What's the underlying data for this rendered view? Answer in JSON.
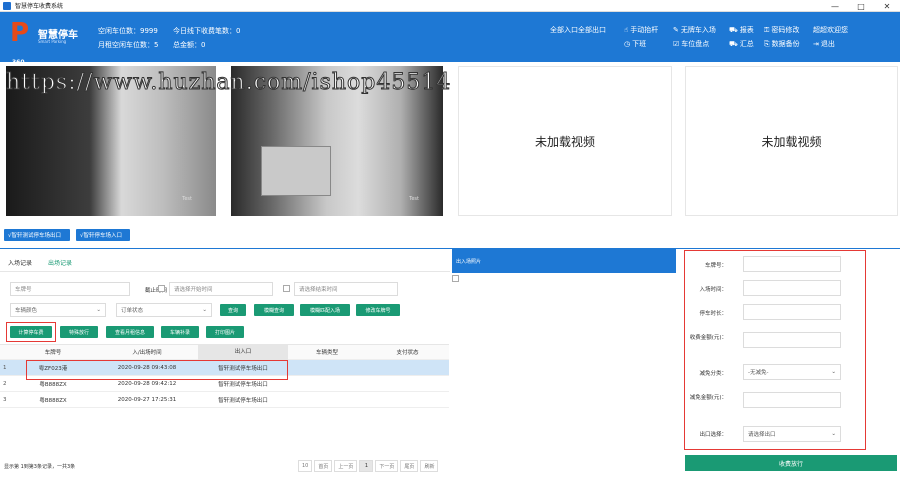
{
  "window": {
    "title": "智慧停车收费系统",
    "controls": [
      "—",
      "□",
      "✕"
    ]
  },
  "brand": {
    "logo": "P",
    "logo_sub": "360",
    "name": "智慧停车",
    "subtitle": "Smart Parking"
  },
  "stats": {
    "free_spaces": "空闲车位数：9999",
    "monthly_free": "月租空闲车位数：5",
    "today_offline": "今日线下收费笔数：0",
    "total_amount": "总金额：0"
  },
  "header_menu": {
    "all_entries": "全部入口全部出口",
    "manual_lift": "手动抬杆",
    "no_plate_entry": "无牌车入场",
    "report": "报表",
    "change_password": "密码修改",
    "welcome": "超超欢迎您",
    "off_duty": "下班",
    "space_count": "车位盘点",
    "summary": "汇总",
    "backup": "数据备份",
    "logout": "退出"
  },
  "watermark": "https://www.huzhan.com/ishop45514",
  "cameras": {
    "cam1_tag": "Test",
    "cam2_tag": "Test",
    "no_video": "未加载视频"
  },
  "gate_buttons": {
    "exit": "√智轩测试停车场出口",
    "entry": "√智轩停车场入口"
  },
  "tabs": {
    "entry_records": "入场记录",
    "exit_records": "出场记录"
  },
  "filters": {
    "plate_placeholder": "车牌号",
    "end_time_label": "截止时间",
    "start_placeholder": "请选择开始时间",
    "end_placeholder": "请选择结束时间",
    "color_select": "车辆颜色",
    "order_status": "订单状态",
    "query": "查询",
    "fuzzy_query": "模糊查询",
    "fuzzy_match_entry": "模糊匹配入场",
    "modify_plate": "修改车牌号",
    "calc_fee": "计算停车费",
    "special_release": "特殊放行",
    "view_monthly": "查看月租信息",
    "vehicle_supplement": "车辆补录",
    "print_image": "打印图片"
  },
  "table": {
    "headers": [
      "车牌号",
      "入/出场时间",
      "出入口",
      "车辆类型",
      "支付状态"
    ],
    "rows": [
      {
        "idx": "1",
        "plate": "粤ZF023港",
        "time": "2020-09-28 09:43:08",
        "gate": "智轩测试停车场出口",
        "type": "",
        "pay": ""
      },
      {
        "idx": "2",
        "plate": "粤B888ZX",
        "time": "2020-09-28 09:42:12",
        "gate": "智轩测试停车场出口",
        "type": "",
        "pay": ""
      },
      {
        "idx": "3",
        "plate": "粤B888ZX",
        "time": "2020-09-27 17:25:31",
        "gate": "智轩测试停车场出口",
        "type": "",
        "pay": ""
      }
    ]
  },
  "footer": {
    "summary": "显示第 1到第3条记录，一共3条"
  },
  "pager": {
    "size": "10",
    "first": "首页",
    "prev": "上一页",
    "current": "1",
    "next": "下一页",
    "last": "尾页",
    "refresh": "刷新"
  },
  "mid_panel": {
    "title": "出入场照片"
  },
  "right_panel": {
    "plate_label": "车牌号：",
    "entry_time_label": "入场时间：",
    "duration_label": "停车时长：",
    "fee_label": "收费金额(元)：",
    "discount_type_label": "减免分类：",
    "discount_type_value": "-无减免-",
    "discount_amount_label": "减免金额(元)：",
    "exit_select_label": "出口选择：",
    "exit_select_value": "请选择出口",
    "charge_button": "收费放行"
  },
  "colors": {
    "primary_blue": "#1e78d4",
    "green": "#1a9a74",
    "highlight_red": "#e53935",
    "selected_row": "#cfe4f7"
  }
}
